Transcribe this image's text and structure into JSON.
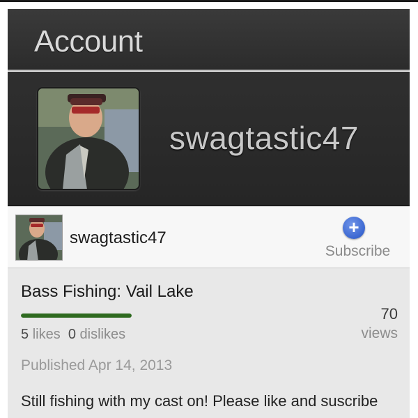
{
  "header": {
    "title": "Account"
  },
  "profile": {
    "username": "swagtastic47",
    "avatar": "profile-photo"
  },
  "video": {
    "owner_name": "swagtastic47",
    "subscribe_label": "Subscribe",
    "subscribe_icon": "plus-icon",
    "title": "Bass Fishing: Vail Lake",
    "likes_count": "5",
    "likes_label": "likes",
    "dislikes_count": "0",
    "dislikes_label": "dislikes",
    "like_ratio": 1.0,
    "view_count": "70",
    "views_label": "views",
    "published": "Published Apr 14, 2013",
    "description": "Still fishing with my cast on! Please like and suscribe"
  },
  "colors": {
    "header_bg": "#2f2f2f",
    "like_bar": "#2e6a1f",
    "subscribe_accent": "#3b67d1"
  }
}
